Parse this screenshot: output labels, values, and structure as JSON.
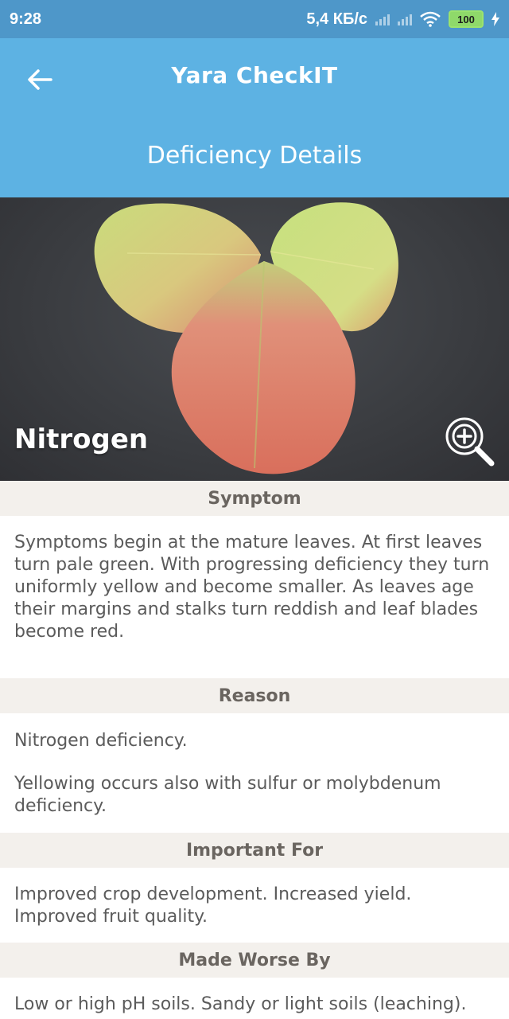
{
  "status_bar": {
    "time": "9:28",
    "network_speed": "5,4 КБ/с",
    "battery": "100"
  },
  "app_bar": {
    "back_icon": "arrow-left-icon",
    "app_title": "Yara CheckIT",
    "page_title": "Deficiency Details"
  },
  "hero": {
    "nutrient_name": "Nitrogen",
    "zoom_icon": "zoom-in-icon"
  },
  "sections": [
    {
      "header": "Symptom",
      "paragraphs": [
        "Symptoms begin at the mature leaves. At first leaves turn pale green. With progressing deficiency they turn uniformly yellow and become smaller. As leaves age their margins and stalks turn reddish and leaf blades become red."
      ]
    },
    {
      "header": "Reason",
      "paragraphs": [
        "Nitrogen deficiency.",
        "Yellowing occurs also with sulfur or molybdenum deficiency."
      ]
    },
    {
      "header": "Important For",
      "paragraphs": [
        "Improved crop development. Increased yield. Improved fruit quality."
      ]
    },
    {
      "header": "Made Worse By",
      "paragraphs": [
        "Low or high pH soils. Sandy or light soils (leaching)."
      ]
    }
  ],
  "colors": {
    "status_bar": "#4e97c9",
    "app_bar": "#5db2e3",
    "section_header_bg": "#f3f0ec",
    "body_text": "#5b5b5b"
  }
}
